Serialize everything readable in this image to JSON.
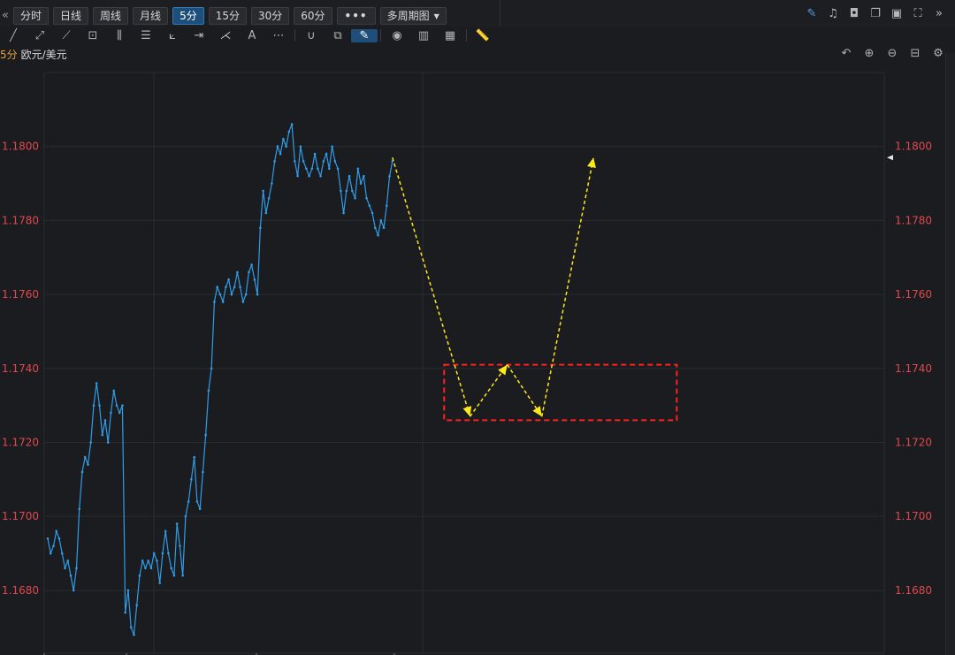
{
  "topbar": {
    "timeframes": [
      "分时",
      "日线",
      "周线",
      "月线",
      "5分",
      "15分",
      "30分",
      "60分"
    ],
    "active_timeframe": "5分",
    "more_label": "•••",
    "multi_period_label": "多周期图"
  },
  "symbol": {
    "timeframe": "5分",
    "name": "欧元/美元"
  },
  "colors": {
    "background": "#1b1c20",
    "price_line": "#2f9de8",
    "axis_label": "#e0484e",
    "arrow": "#ffe81a",
    "highlight_box": "#ff2020",
    "grid": "#2a2b30",
    "active_button": "#1e4f7a"
  },
  "icons": {
    "top_right": [
      "pen-icon",
      "bell-icon",
      "camera-icon",
      "copy-icon",
      "monitor-icon",
      "fullscreen-icon",
      "chevron-right-icon"
    ],
    "toolbar": [
      "line-icon",
      "ray-icon",
      "polyline-icon",
      "crop-icon",
      "bars-icon",
      "fib-icon",
      "fan-icon",
      "range-icon",
      "gann-icon",
      "text-icon",
      "more-icon",
      "magnet-icon",
      "layers-icon",
      "brush-icon",
      "eye-icon",
      "trash-icon",
      "grid-icon",
      "ruler-icon"
    ],
    "chart_controls": [
      "undo-icon",
      "zoom-in-icon",
      "zoom-out-icon",
      "crop-view-icon",
      "settings-icon"
    ]
  },
  "chart_data": {
    "type": "line",
    "title": "欧元/美元",
    "xlabel": "",
    "ylabel": "",
    "ylim": [
      1.1663,
      1.182
    ],
    "y_ticks": [
      "1.1680",
      "1.1700",
      "1.1720",
      "1.1740",
      "1.1760",
      "1.1780",
      "1.1800"
    ],
    "grid": true,
    "series": [
      {
        "name": "",
        "values": [
          1.1694,
          1.169,
          1.1692,
          1.1696,
          1.1694,
          1.169,
          1.1686,
          1.1688,
          1.1684,
          1.168,
          1.1686,
          1.1702,
          1.1712,
          1.1716,
          1.1714,
          1.172,
          1.173,
          1.1736,
          1.173,
          1.1722,
          1.1726,
          1.172,
          1.1728,
          1.1734,
          1.173,
          1.1728,
          1.173,
          1.1674,
          1.168,
          1.167,
          1.1668,
          1.1676,
          1.1684,
          1.1688,
          1.1686,
          1.1688,
          1.1686,
          1.169,
          1.1688,
          1.1682,
          1.169,
          1.1696,
          1.169,
          1.1686,
          1.1684,
          1.1698,
          1.1692,
          1.1684,
          1.17,
          1.1704,
          1.171,
          1.1716,
          1.1704,
          1.1702,
          1.1712,
          1.1722,
          1.1734,
          1.174,
          1.1758,
          1.1762,
          1.176,
          1.1758,
          1.1762,
          1.1764,
          1.176,
          1.1762,
          1.1766,
          1.1762,
          1.1758,
          1.176,
          1.1766,
          1.1768,
          1.1764,
          1.176,
          1.1778,
          1.1788,
          1.1782,
          1.1786,
          1.179,
          1.1796,
          1.18,
          1.1798,
          1.1802,
          1.18,
          1.1804,
          1.1806,
          1.1796,
          1.1792,
          1.18,
          1.1796,
          1.1794,
          1.1792,
          1.1794,
          1.1798,
          1.1794,
          1.1792,
          1.1796,
          1.1798,
          1.1794,
          1.18,
          1.1796,
          1.1794,
          1.1788,
          1.1782,
          1.1788,
          1.1792,
          1.1788,
          1.1786,
          1.1794,
          1.179,
          1.1792,
          1.1786,
          1.1784,
          1.1782,
          1.1778,
          1.1776,
          1.178,
          1.1778,
          1.1784,
          1.1792,
          1.1796
        ]
      }
    ],
    "annotations": {
      "arrow_path": [
        [
          120,
          1.1797
        ],
        [
          147,
          1.1727
        ],
        [
          160,
          1.1741
        ],
        [
          172,
          1.1727
        ],
        [
          190,
          1.1797
        ]
      ],
      "box": {
        "x_start": 138,
        "x_end": 219,
        "y_low": 1.1726,
        "y_high": 1.1741
      }
    }
  }
}
